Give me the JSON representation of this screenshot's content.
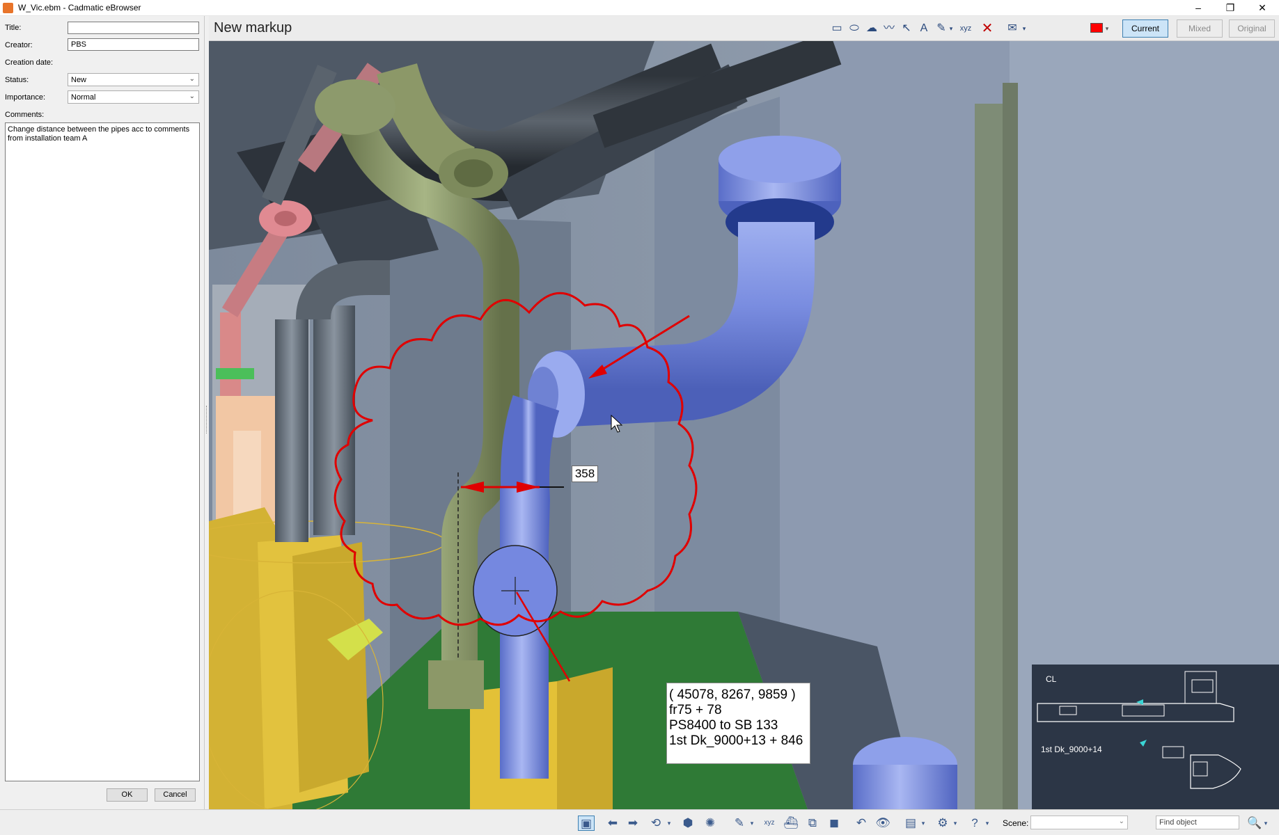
{
  "window": {
    "title": "W_Vic.ebm - Cadmatic eBrowser",
    "minimize": "–",
    "restore": "❐",
    "close": "✕"
  },
  "form": {
    "title_label": "Title:",
    "title_value": "",
    "creator_label": "Creator:",
    "creator_value": "PBS",
    "creation_date_label": "Creation date:",
    "status_label": "Status:",
    "status_value": "New",
    "importance_label": "Importance:",
    "importance_value": "Normal",
    "comments_label": "Comments:",
    "comments_value": "Change distance between the pipes acc to comments from installation team A",
    "ok_label": "OK",
    "cancel_label": "Cancel"
  },
  "markup": {
    "title": "New markup",
    "modes": [
      "Current",
      "Mixed",
      "Original"
    ],
    "active_mode": "Current",
    "pen_color": "#ff0000",
    "tools": [
      "rectangle-icon",
      "ellipse-icon",
      "cloud-icon",
      "freehand-icon",
      "arrow-icon",
      "text-icon",
      "measure-icon",
      "xyz-coordinate-icon",
      "delete-icon",
      "envelope-icon",
      "color-picker-icon"
    ]
  },
  "viewport": {
    "dimension_value": "358",
    "coordinate_lines": [
      "( 45078, 8267, 9859 )",
      "fr75 + 78",
      "PS8400 to SB 133",
      "1st Dk_9000+13 + 846"
    ]
  },
  "minimap": {
    "cl_label": "CL",
    "deck_label": "1st Dk_9000+14"
  },
  "statusbar": {
    "scene_label": "Scene:",
    "scene_value": "",
    "find_placeholder": "Find object"
  }
}
